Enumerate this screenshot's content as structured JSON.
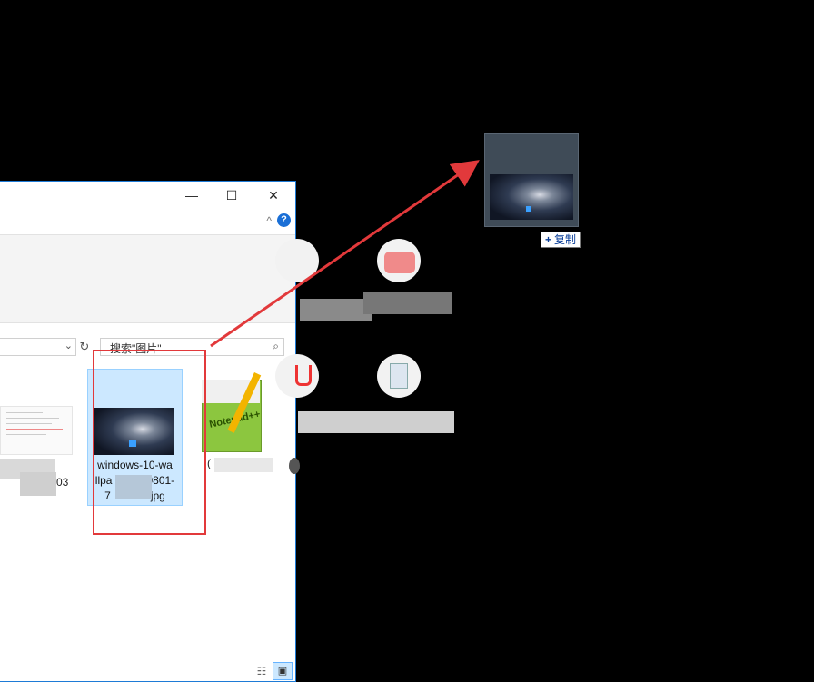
{
  "window": {
    "controls": {
      "minimize": "—",
      "maximize": "☐",
      "close": "✕"
    },
    "help_label": "?",
    "ribbon_collapse_glyph": "^"
  },
  "address": {
    "dropdown_glyph": "⌄",
    "refresh_glyph": "↻"
  },
  "search": {
    "placeholder": "搜索\"图片\"",
    "icon": "search-icon"
  },
  "files": [
    {
      "name_partial": "03",
      "thumbnail": "document-screenshot"
    },
    {
      "name": "windows-10-wallpaper-…0801-7592372.jpg",
      "name_lines": [
        "windows-10-wa",
        "llpa",
        "0801-",
        "7",
        "2372.jpg"
      ],
      "selected": true,
      "thumbnail": "galaxy-wallpaper"
    },
    {
      "name_partial": "(",
      "thumbnail": "notepad-plus-plus-icon",
      "logo_text": "Notepad++"
    }
  ],
  "view": {
    "details_glyph": "☷",
    "thumbnails_glyph": "▣"
  },
  "drag": {
    "copy_label": "复制",
    "copy_plus": "+"
  },
  "colors": {
    "highlight": "#e2393b",
    "selection_bg": "#cce8ff",
    "window_border": "#1e7bd6",
    "tooltip_text": "#0b3f99"
  }
}
